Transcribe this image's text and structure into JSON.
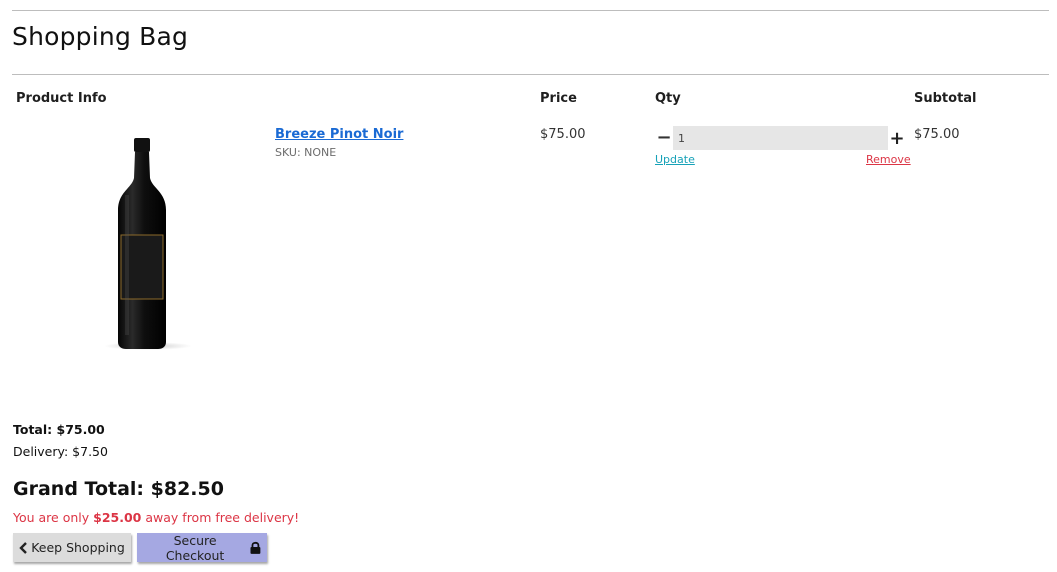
{
  "page": {
    "title": "Shopping Bag"
  },
  "table": {
    "headers": {
      "product_info": "Product Info",
      "price": "Price",
      "qty": "Qty",
      "subtotal": "Subtotal"
    },
    "items": [
      {
        "name": "Breeze Pinot Noir",
        "sku": "SKU: NONE",
        "price": "$75.00",
        "qty": "1",
        "subtotal": "$75.00",
        "update_label": "Update",
        "remove_label": "Remove",
        "image_icon": "wine-bottle-image"
      }
    ]
  },
  "summary": {
    "total": "Total: $75.00",
    "delivery": "Delivery: $7.50",
    "grand_total": "Grand Total: $82.50",
    "free_delivery_prefix": "You are only",
    "free_delivery_amount": "$25.00",
    "free_delivery_suffix": "away from free delivery!"
  },
  "actions": {
    "keep_shopping": "Keep Shopping",
    "secure_checkout": "Secure Checkout"
  },
  "colors": {
    "link": "#1a6ad4",
    "update": "#17a2b8",
    "danger": "#dc3545",
    "checkout_button": "#a5a8e2",
    "keep_button": "#dcdcdc"
  }
}
